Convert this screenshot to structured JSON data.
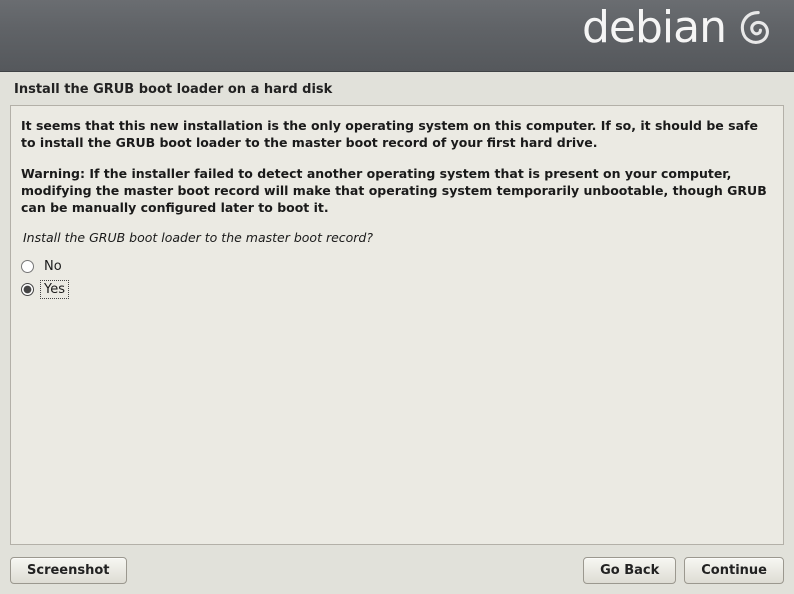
{
  "header": {
    "brand": "debian"
  },
  "title": "Install the GRUB boot loader on a hard disk",
  "body": {
    "para1": "It seems that this new installation is the only operating system on this computer. If so, it should be safe to install the GRUB boot loader to the master boot record of your first hard drive.",
    "para2": "Warning: If the installer failed to detect another operating system that is present on your computer, modifying the master boot record will make that operating system temporarily unbootable, though GRUB can be manually configured later to boot it.",
    "question": "Install the GRUB boot loader to the master boot record?"
  },
  "options": {
    "no": {
      "label": "No",
      "selected": false
    },
    "yes": {
      "label": "Yes",
      "selected": true
    }
  },
  "buttons": {
    "screenshot": "Screenshot",
    "go_back": "Go Back",
    "continue": "Continue"
  }
}
